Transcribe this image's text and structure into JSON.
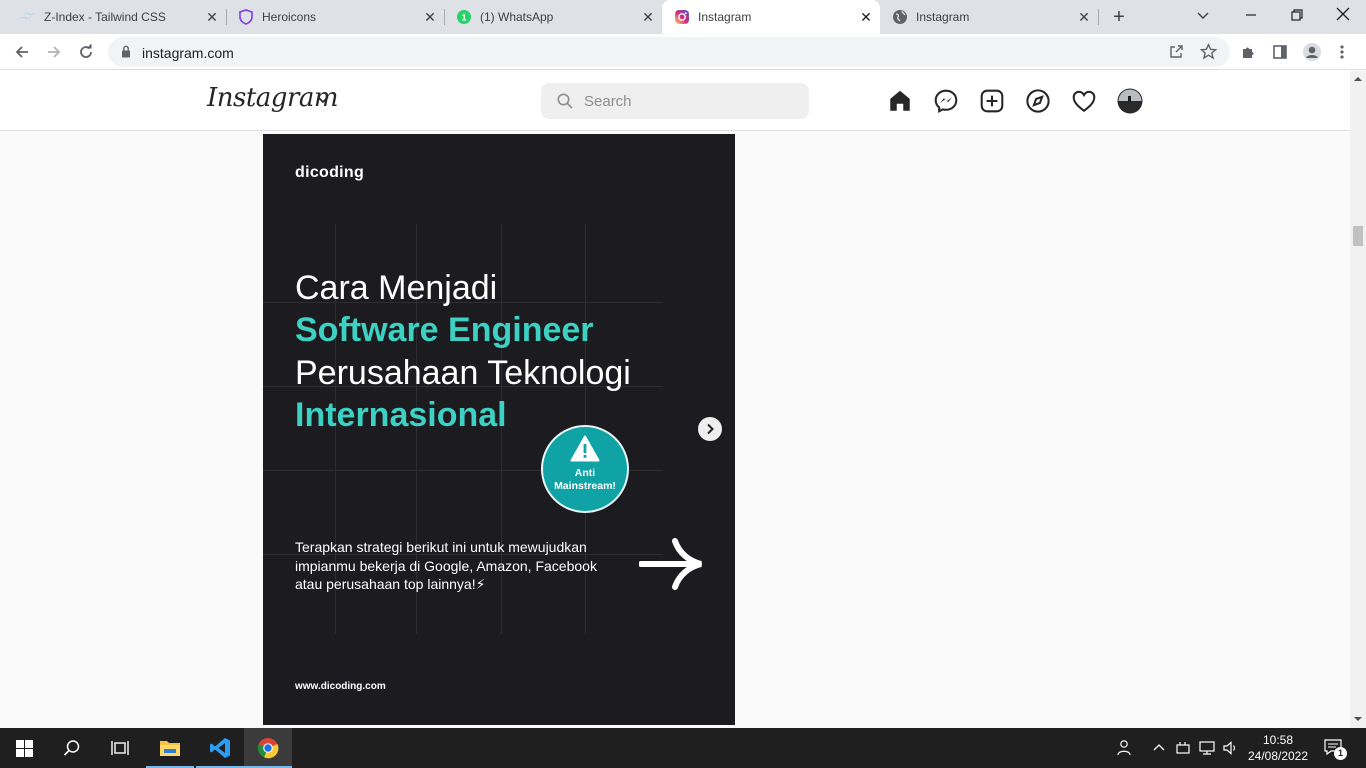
{
  "browser": {
    "tabs": [
      {
        "title": "Z-Index - Tailwind CSS",
        "icon": "tailwind-icon"
      },
      {
        "title": "Heroicons",
        "icon": "heroicons-icon"
      },
      {
        "title": "(1) WhatsApp",
        "icon": "whatsapp-icon"
      },
      {
        "title": "Instagram",
        "icon": "instagram-icon",
        "active": true
      },
      {
        "title": "Instagram",
        "icon": "globe-icon"
      }
    ],
    "url": "instagram.com"
  },
  "instagram": {
    "logo": "Instagram",
    "search_placeholder": "Search",
    "nav_icons": [
      "home-icon",
      "messenger-icon",
      "new-post-icon",
      "explore-icon",
      "activity-heart-icon",
      "profile-avatar"
    ]
  },
  "post": {
    "brand": "dicoding",
    "headline_1": "Cara Menjadi",
    "headline_2": "Software Engineer",
    "headline_3": "Perusahaan Teknologi",
    "headline_4": "Internasional",
    "badge_line_1": "Anti",
    "badge_line_2": "Mainstream!",
    "body": "Terapkan strategi berikut ini untuk mewujudkan impianmu bekerja di Google, Amazon, Facebook atau perusahaan top lainnya!⚡",
    "footer_url": "www.dicoding.com",
    "accent_color": "#3cd1c3"
  },
  "taskbar": {
    "apps": [
      "windows-start-icon",
      "search-icon",
      "task-view-icon",
      "file-explorer-icon",
      "vscode-icon",
      "chrome-icon"
    ],
    "time": "10:58",
    "date": "24/08/2022",
    "notification_count": "1"
  }
}
